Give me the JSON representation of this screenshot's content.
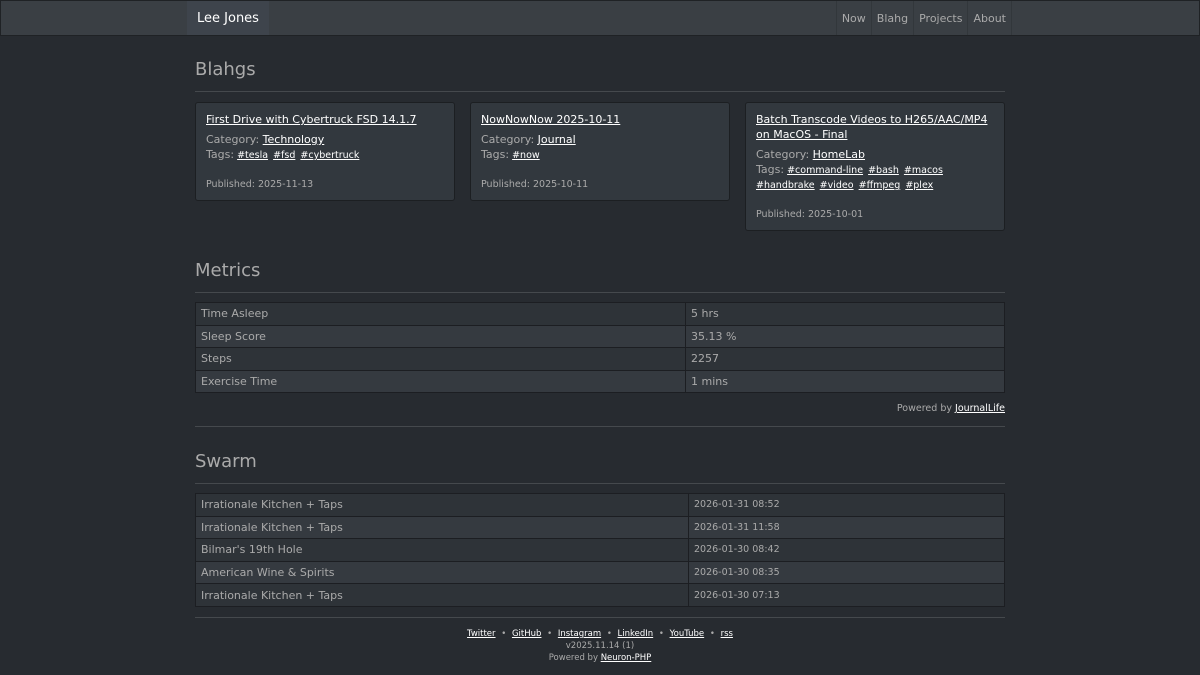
{
  "navbar": {
    "brand": "Lee Jones",
    "links": [
      "Now",
      "Blahg",
      "Projects",
      "About"
    ]
  },
  "blahgs": {
    "heading": "Blahgs",
    "category_label": "Category:",
    "tags_label": "Tags:",
    "published_label": "Published:",
    "cards": [
      {
        "title": "First Drive with Cybertruck FSD 14.1.7",
        "category": "Technology",
        "tags": [
          "#tesla",
          "#fsd",
          "#cybertruck"
        ],
        "published": "2025-11-13"
      },
      {
        "title": "NowNowNow 2025-10-11",
        "category": "Journal",
        "tags": [
          "#now"
        ],
        "published": "2025-10-11"
      },
      {
        "title": "Batch Transcode Videos to H265/AAC/MP4 on MacOS - Final",
        "category": "HomeLab",
        "tags": [
          "#command-line",
          "#bash",
          "#macos",
          "#handbrake",
          "#video",
          "#ffmpeg",
          "#plex"
        ],
        "published": "2025-10-01"
      }
    ]
  },
  "metrics": {
    "heading": "Metrics",
    "rows": [
      {
        "label": "Time Asleep",
        "value": "5 hrs"
      },
      {
        "label": "Sleep Score",
        "value": "35.13 %"
      },
      {
        "label": "Steps",
        "value": "2257"
      },
      {
        "label": "Exercise Time",
        "value": "1 mins"
      }
    ],
    "powered_prefix": "Powered by",
    "powered_link": "JournalLife"
  },
  "swarm": {
    "heading": "Swarm",
    "rows": [
      {
        "venue": "Irrationale Kitchen + Taps",
        "time": "2026-01-31 08:52"
      },
      {
        "venue": "Irrationale Kitchen + Taps",
        "time": "2026-01-31 11:58"
      },
      {
        "venue": "Bilmar's 19th Hole",
        "time": "2026-01-30 08:42"
      },
      {
        "venue": "American Wine & Spirits",
        "time": "2026-01-30 08:35"
      },
      {
        "venue": "Irrationale Kitchen + Taps",
        "time": "2026-01-30 07:13"
      }
    ]
  },
  "footer": {
    "links": [
      "Twitter",
      "GitHub",
      "Instagram",
      "LinkedIn",
      "YouTube",
      "rss"
    ],
    "separator": "•",
    "version": "v2025.11.14 (1)",
    "powered_prefix": "Powered by",
    "powered_link": "Neuron-PHP"
  }
}
